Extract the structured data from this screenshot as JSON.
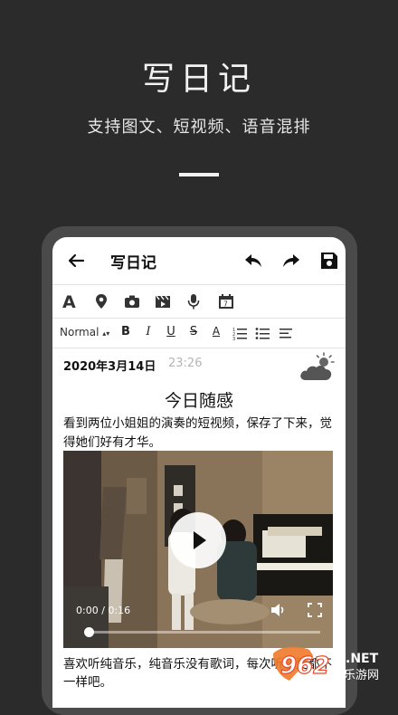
{
  "hero": {
    "title": "写日记",
    "subtitle": "支持图文、短视频、语音混排"
  },
  "app": {
    "header_title": "写日记",
    "icons": {
      "back": "back-arrow-icon",
      "undo": "undo-icon",
      "redo": "redo-icon",
      "save": "save-icon"
    },
    "toolbar1": [
      "text-style-icon",
      "location-icon",
      "camera-icon",
      "video-icon",
      "microphone-icon",
      "calendar-icon"
    ],
    "format": {
      "style_value": "Normal",
      "bold": "B",
      "italic": "I",
      "underline": "U",
      "strike": "S",
      "font_color_label": "A"
    }
  },
  "note": {
    "date": "2020年3月14日",
    "time": "23:26",
    "weather_icon": "partly-cloudy-icon",
    "title": "今日随感",
    "paragraph1": "看到两位小姐姐的演奏的短视频，保存了下来，觉得她们好有才华。",
    "video_time": "0:00 / 0:16",
    "video_progress": 0,
    "paragraph2": "喜欢听纯音乐，纯音乐没有歌词，每次听感受都不一样吧。"
  },
  "watermark": {
    "brand": "962",
    "suffix": ".NET",
    "site": "乐游网"
  },
  "colors": {
    "background": "#2b2b2b",
    "phone_frame": "#4a4a4a",
    "screen": "#ffffff",
    "accent_watermark": "#e9492a"
  }
}
